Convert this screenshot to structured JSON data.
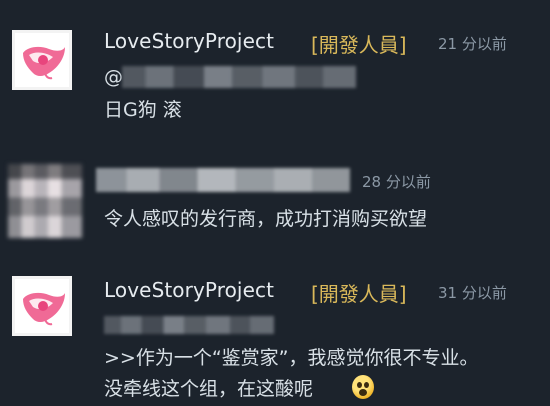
{
  "comments": [
    {
      "author": "LoveStoryProject",
      "badge": "[開發人員]",
      "time": "21 分以前",
      "mention_prefix": "@",
      "lines": [
        "日G狗 滚"
      ],
      "avatar_icon": "heart-logo-icon"
    },
    {
      "author": "",
      "badge": "",
      "time": "28 分以前",
      "lines": [
        "令人感叹的发行商，成功打消购买欲望"
      ],
      "avatar_icon": "blurred-avatar"
    },
    {
      "author": "LoveStoryProject",
      "badge": "[開發人員]",
      "time": "31 分以前",
      "lines": [
        ">>作为一个“鉴赏家”，我感觉你很不专业。",
        "没牵线这个组，在这酸呢"
      ],
      "avatar_icon": "heart-logo-icon",
      "trailing_emoji": "laughing-emoji-icon"
    }
  ],
  "colors": {
    "background": "#1c232c",
    "developer_badge": "#d9b85a",
    "timestamp": "#8b98a5",
    "author": "#e6ebef"
  }
}
